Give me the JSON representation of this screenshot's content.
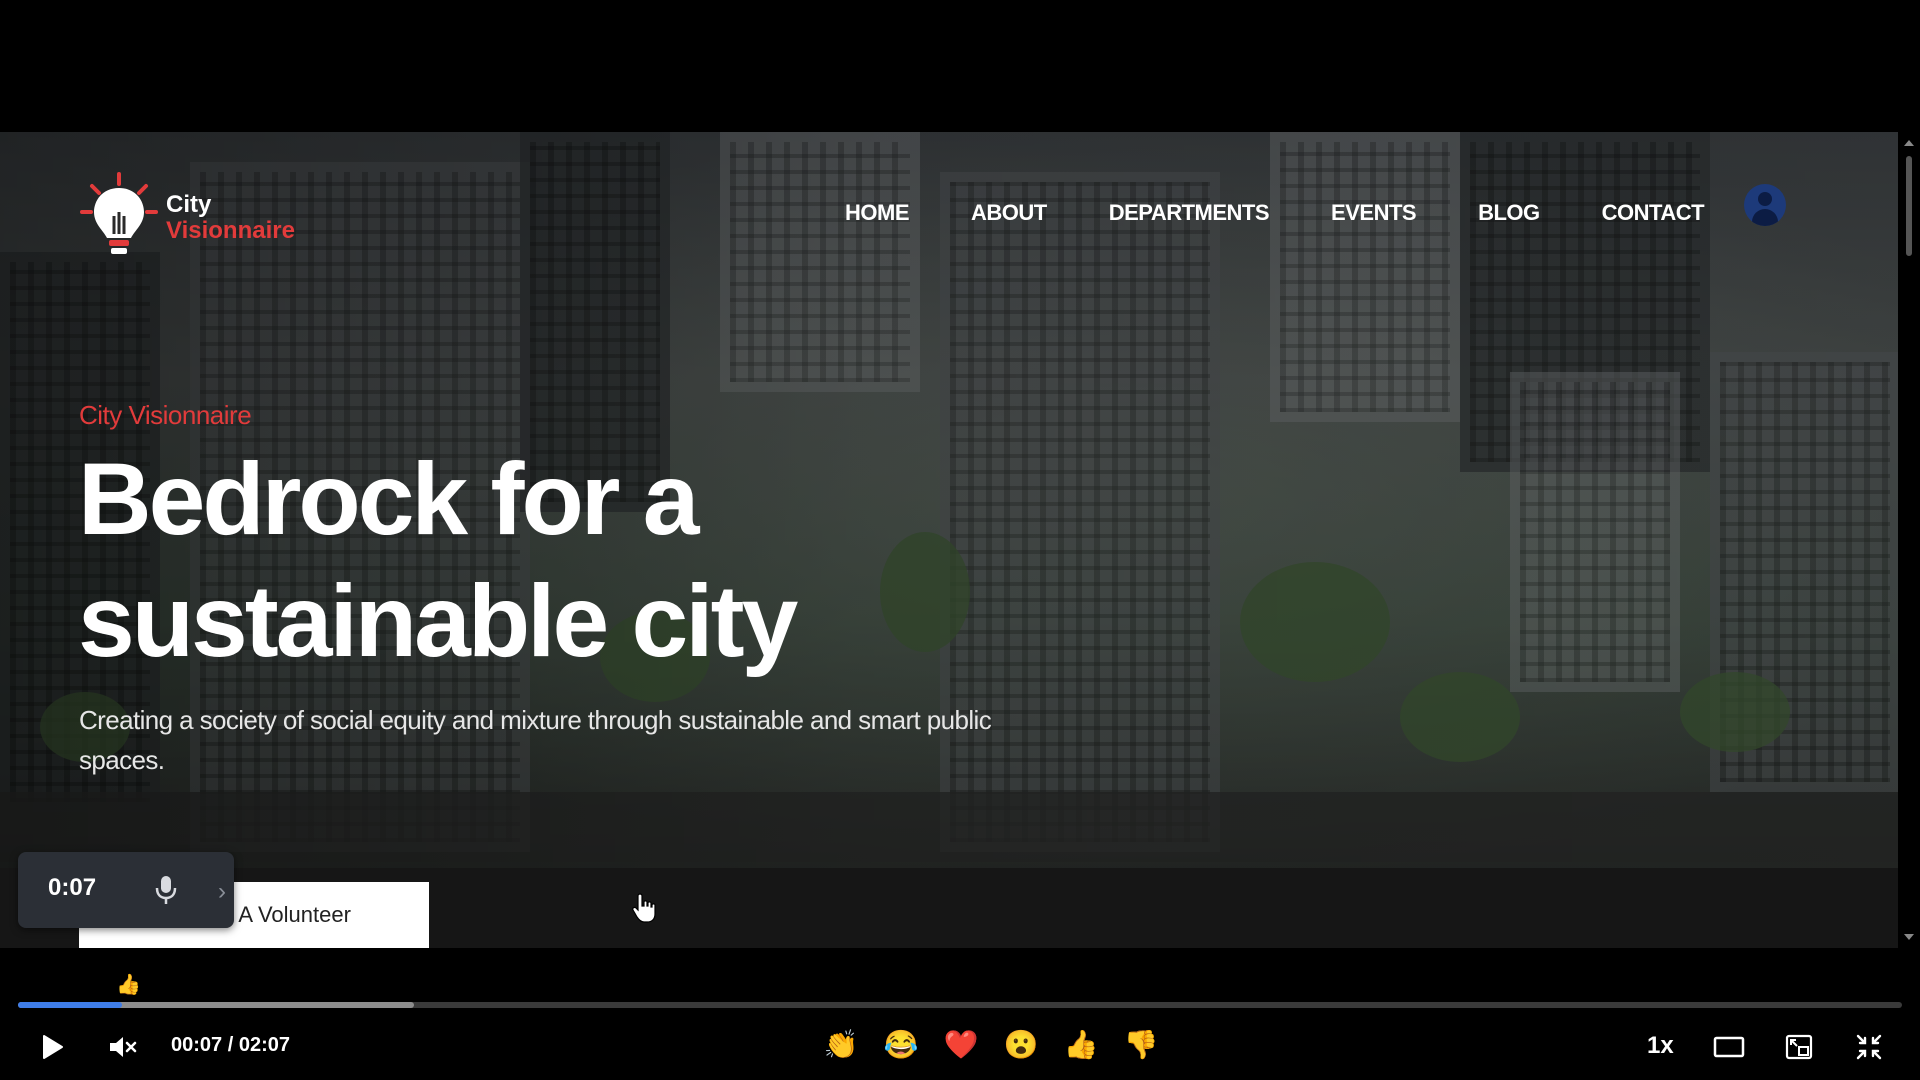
{
  "site": {
    "logo": {
      "line1": "City",
      "line2": "Visionnaire"
    },
    "nav": [
      "HOME",
      "ABOUT",
      "DEPARTMENTS",
      "EVENTS",
      "BLOG",
      "CONTACT"
    ],
    "hero": {
      "eyebrow": "City Visionnaire",
      "title_line1": "Bedrock for a",
      "title_line2": "sustainable city",
      "subtitle": "Creating a society of social equity and mixture through sustainable and smart public spaces.",
      "cta_partial": "ne A Volunteer"
    }
  },
  "recorder": {
    "time": "0:07"
  },
  "player": {
    "floating_reaction": "👍",
    "time_readout": "00:07 / 02:07",
    "played_fraction": 0.055,
    "buffered_fraction": 0.21,
    "reactions": [
      "👏",
      "😂",
      "❤️",
      "😮",
      "👍",
      "👎"
    ],
    "speed": "1x",
    "colors": {
      "played": "#3f7de8",
      "accent_red": "#e23b3b"
    }
  }
}
